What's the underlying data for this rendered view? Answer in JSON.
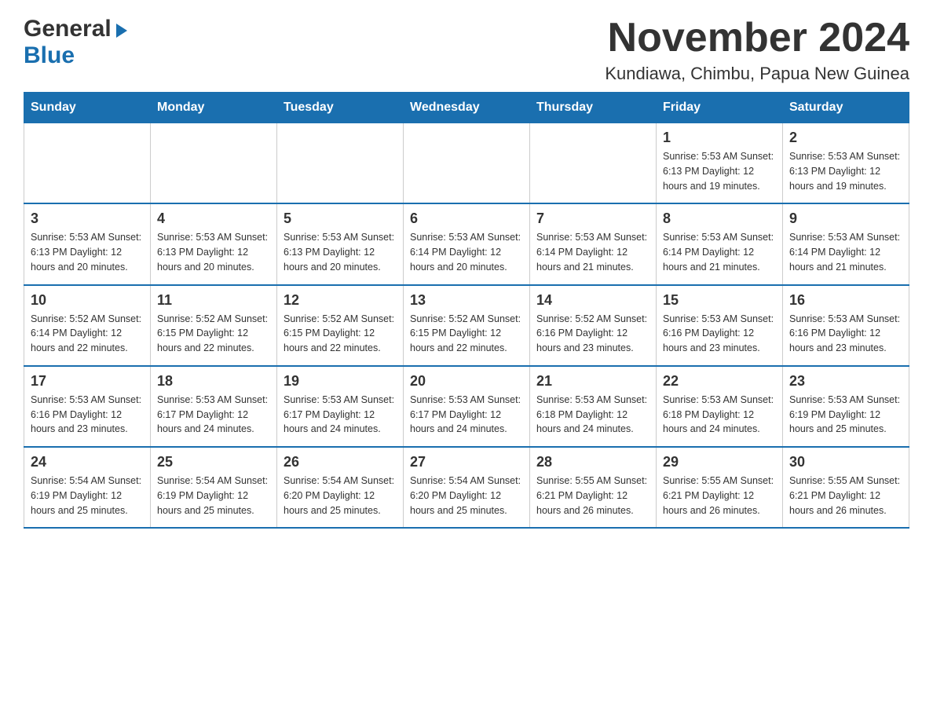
{
  "header": {
    "logo_general": "General",
    "logo_blue": "Blue",
    "month_title": "November 2024",
    "location": "Kundiawa, Chimbu, Papua New Guinea"
  },
  "days_of_week": [
    "Sunday",
    "Monday",
    "Tuesday",
    "Wednesday",
    "Thursday",
    "Friday",
    "Saturday"
  ],
  "weeks": [
    [
      {
        "day": "",
        "info": ""
      },
      {
        "day": "",
        "info": ""
      },
      {
        "day": "",
        "info": ""
      },
      {
        "day": "",
        "info": ""
      },
      {
        "day": "",
        "info": ""
      },
      {
        "day": "1",
        "info": "Sunrise: 5:53 AM\nSunset: 6:13 PM\nDaylight: 12 hours\nand 19 minutes."
      },
      {
        "day": "2",
        "info": "Sunrise: 5:53 AM\nSunset: 6:13 PM\nDaylight: 12 hours\nand 19 minutes."
      }
    ],
    [
      {
        "day": "3",
        "info": "Sunrise: 5:53 AM\nSunset: 6:13 PM\nDaylight: 12 hours\nand 20 minutes."
      },
      {
        "day": "4",
        "info": "Sunrise: 5:53 AM\nSunset: 6:13 PM\nDaylight: 12 hours\nand 20 minutes."
      },
      {
        "day": "5",
        "info": "Sunrise: 5:53 AM\nSunset: 6:13 PM\nDaylight: 12 hours\nand 20 minutes."
      },
      {
        "day": "6",
        "info": "Sunrise: 5:53 AM\nSunset: 6:14 PM\nDaylight: 12 hours\nand 20 minutes."
      },
      {
        "day": "7",
        "info": "Sunrise: 5:53 AM\nSunset: 6:14 PM\nDaylight: 12 hours\nand 21 minutes."
      },
      {
        "day": "8",
        "info": "Sunrise: 5:53 AM\nSunset: 6:14 PM\nDaylight: 12 hours\nand 21 minutes."
      },
      {
        "day": "9",
        "info": "Sunrise: 5:53 AM\nSunset: 6:14 PM\nDaylight: 12 hours\nand 21 minutes."
      }
    ],
    [
      {
        "day": "10",
        "info": "Sunrise: 5:52 AM\nSunset: 6:14 PM\nDaylight: 12 hours\nand 22 minutes."
      },
      {
        "day": "11",
        "info": "Sunrise: 5:52 AM\nSunset: 6:15 PM\nDaylight: 12 hours\nand 22 minutes."
      },
      {
        "day": "12",
        "info": "Sunrise: 5:52 AM\nSunset: 6:15 PM\nDaylight: 12 hours\nand 22 minutes."
      },
      {
        "day": "13",
        "info": "Sunrise: 5:52 AM\nSunset: 6:15 PM\nDaylight: 12 hours\nand 22 minutes."
      },
      {
        "day": "14",
        "info": "Sunrise: 5:52 AM\nSunset: 6:16 PM\nDaylight: 12 hours\nand 23 minutes."
      },
      {
        "day": "15",
        "info": "Sunrise: 5:53 AM\nSunset: 6:16 PM\nDaylight: 12 hours\nand 23 minutes."
      },
      {
        "day": "16",
        "info": "Sunrise: 5:53 AM\nSunset: 6:16 PM\nDaylight: 12 hours\nand 23 minutes."
      }
    ],
    [
      {
        "day": "17",
        "info": "Sunrise: 5:53 AM\nSunset: 6:16 PM\nDaylight: 12 hours\nand 23 minutes."
      },
      {
        "day": "18",
        "info": "Sunrise: 5:53 AM\nSunset: 6:17 PM\nDaylight: 12 hours\nand 24 minutes."
      },
      {
        "day": "19",
        "info": "Sunrise: 5:53 AM\nSunset: 6:17 PM\nDaylight: 12 hours\nand 24 minutes."
      },
      {
        "day": "20",
        "info": "Sunrise: 5:53 AM\nSunset: 6:17 PM\nDaylight: 12 hours\nand 24 minutes."
      },
      {
        "day": "21",
        "info": "Sunrise: 5:53 AM\nSunset: 6:18 PM\nDaylight: 12 hours\nand 24 minutes."
      },
      {
        "day": "22",
        "info": "Sunrise: 5:53 AM\nSunset: 6:18 PM\nDaylight: 12 hours\nand 24 minutes."
      },
      {
        "day": "23",
        "info": "Sunrise: 5:53 AM\nSunset: 6:19 PM\nDaylight: 12 hours\nand 25 minutes."
      }
    ],
    [
      {
        "day": "24",
        "info": "Sunrise: 5:54 AM\nSunset: 6:19 PM\nDaylight: 12 hours\nand 25 minutes."
      },
      {
        "day": "25",
        "info": "Sunrise: 5:54 AM\nSunset: 6:19 PM\nDaylight: 12 hours\nand 25 minutes."
      },
      {
        "day": "26",
        "info": "Sunrise: 5:54 AM\nSunset: 6:20 PM\nDaylight: 12 hours\nand 25 minutes."
      },
      {
        "day": "27",
        "info": "Sunrise: 5:54 AM\nSunset: 6:20 PM\nDaylight: 12 hours\nand 25 minutes."
      },
      {
        "day": "28",
        "info": "Sunrise: 5:55 AM\nSunset: 6:21 PM\nDaylight: 12 hours\nand 26 minutes."
      },
      {
        "day": "29",
        "info": "Sunrise: 5:55 AM\nSunset: 6:21 PM\nDaylight: 12 hours\nand 26 minutes."
      },
      {
        "day": "30",
        "info": "Sunrise: 5:55 AM\nSunset: 6:21 PM\nDaylight: 12 hours\nand 26 minutes."
      }
    ]
  ],
  "colors": {
    "header_bg": "#1a6faf",
    "header_text": "#ffffff",
    "border": "#1a6faf",
    "text": "#333333",
    "logo_blue": "#1a6faf"
  }
}
